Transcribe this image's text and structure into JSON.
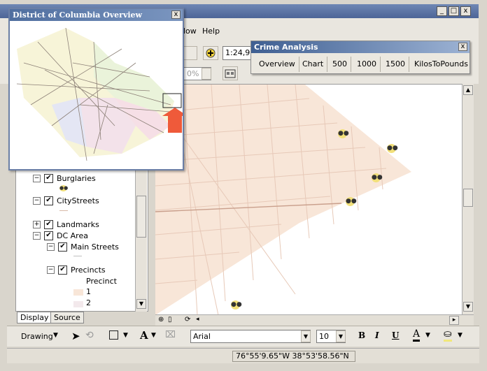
{
  "window": {
    "minimize": "_",
    "maximize": "□",
    "close": "x"
  },
  "menu": {
    "items": [
      "low",
      "Help"
    ]
  },
  "toolbar": {
    "scale_value": "1:24,9",
    "zoom_percent": "0%"
  },
  "overview": {
    "title": "District of Columbia Overview",
    "close": "x"
  },
  "crime_analysis": {
    "title": "Crime Analysis",
    "close": "x",
    "buttons": [
      "Overview",
      "Chart",
      "500",
      "1000",
      "1500",
      "KilosToPounds"
    ]
  },
  "toc": {
    "layers": [
      {
        "label": "Burglaries",
        "expand": "−",
        "checked": "✔"
      },
      {
        "label": "CityStreets",
        "expand": "−",
        "checked": "✔"
      },
      {
        "label": "Landmarks",
        "expand": "+",
        "checked": "✔"
      },
      {
        "label": "DC Area",
        "expand": "−",
        "checked": "✔"
      },
      {
        "label": "Main Streets",
        "expand": "−",
        "checked": "✔"
      },
      {
        "label": "Precincts",
        "expand": "−",
        "checked": "✔"
      }
    ],
    "precinct_heading": "Precinct",
    "precinct_values": [
      "1",
      "2"
    ],
    "tabs": [
      "Display",
      "Source"
    ]
  },
  "drawing_bar": {
    "drawing_label": "Drawing",
    "font_name": "Arial",
    "font_size": "10",
    "bold": "B",
    "italic": "I",
    "underline": "U",
    "font_color": "A"
  },
  "status": {
    "coordinates": "76°55'9.65\"W  38°53'58.56\"N"
  },
  "colors": {
    "title_bar": "#4d6597",
    "overview_frame": "#6b7fa6",
    "arrow": "#ef5a3a",
    "burglary_symbol": "#f2e07a",
    "precinct_fill": "#f8e6d8"
  }
}
